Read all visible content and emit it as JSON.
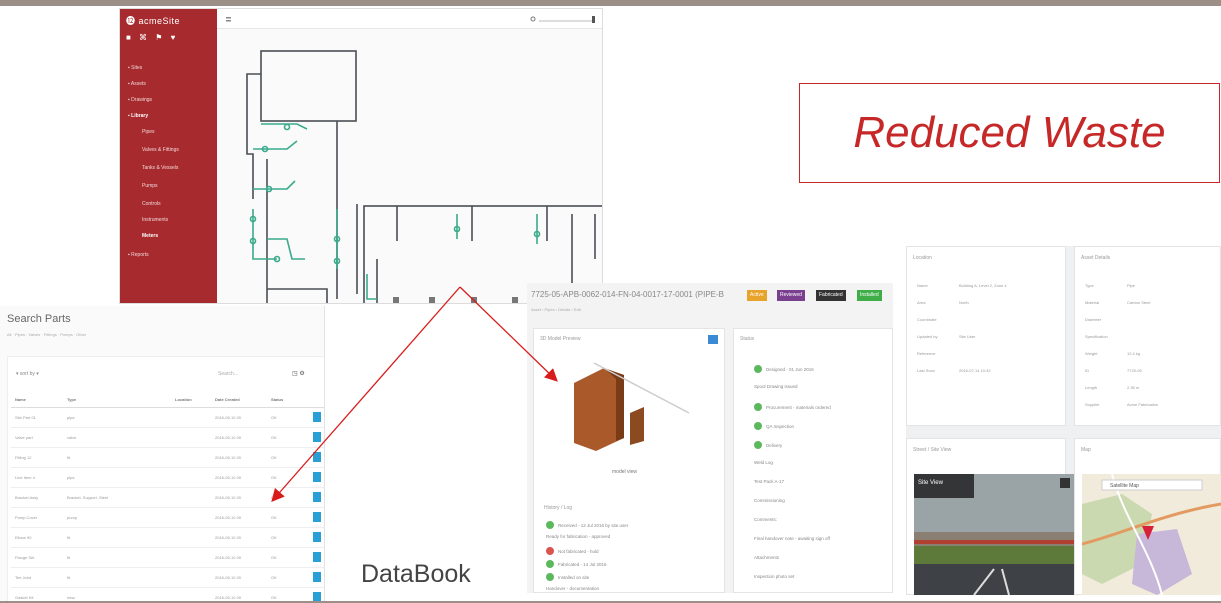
{
  "floorplan_app": {
    "brand": "⓬ acmeSite",
    "sidebar_icons": "■ ⌘ ⚑ ♥",
    "nav": [
      {
        "label": "▪ Sites"
      },
      {
        "label": "▪ Assets"
      },
      {
        "label": "▪ Drawings"
      },
      {
        "label": "▪ Library"
      },
      {
        "label": "Pipes"
      },
      {
        "label": "Valves & Fittings"
      },
      {
        "label": "Tanks & Vessels"
      },
      {
        "label": "Pumps"
      },
      {
        "label": "Controls"
      },
      {
        "label": "Instruments"
      },
      {
        "label": "Meters"
      },
      {
        "label": "▪ Reports"
      }
    ],
    "colors": {
      "sidebar": "#a62a2e",
      "pipe": "#3aaa8c"
    }
  },
  "callout": {
    "text": "Reduced Waste",
    "color": "#c62828"
  },
  "search_list": {
    "title": "Search Parts",
    "tabs": "All · Pipes · Valves · Fittings · Pumps · Other",
    "sort_label": "▾ sort by ▾",
    "search_placeholder": "Search...",
    "tools": "◳ ⚙",
    "columns": [
      "Name",
      "Type",
      "Location",
      "Date Created",
      "Status",
      ""
    ],
    "rows": [
      [
        "Site Part 01",
        "pipe",
        "",
        "2016-05-10 09",
        "OK"
      ],
      [
        "Valve part",
        "valve",
        "",
        "2016-05-10 09",
        "OK"
      ],
      [
        "Fitting 12",
        "fit",
        "",
        "2016-05-10 09",
        "OK"
      ],
      [
        "Line Item 4",
        "pipe",
        "",
        "2016-05-10 09",
        "OK"
      ],
      [
        "Bracket Assy",
        "Bracket, Support, Steel",
        "",
        "2016-05-10 09",
        "OK"
      ],
      [
        "Pump Cover",
        "pump",
        "",
        "2016-05-10 09",
        "OK"
      ],
      [
        "Elbow 90",
        "fit",
        "",
        "2016-05-10 09",
        "OK"
      ],
      [
        "Flange Set",
        "fit",
        "",
        "2016-05-10 09",
        "OK"
      ],
      [
        "Tee Joint",
        "fit",
        "",
        "2016-05-10 09",
        "OK"
      ],
      [
        "Gasket Kit",
        "misc",
        "",
        "2016-05-10 09",
        "OK"
      ]
    ]
  },
  "asset_detail": {
    "title": "7725-05-APB-0062-014-FN-04-0017-17-0001 (PIPE-B",
    "subtitle": "Asset › Pipes › Details › Edit",
    "badges": [
      {
        "label": "Active",
        "color": "#e8a32b"
      },
      {
        "label": "Reviewed",
        "color": "#7a3f8e"
      },
      {
        "label": "Fabricated",
        "color": "#333333"
      },
      {
        "label": "Installed",
        "color": "#3fae49"
      }
    ],
    "model_header": "3D Model Preview",
    "model_label": "model view",
    "history_header": "History / Log",
    "history": [
      {
        "text": "Received - 12 Jul 2016 by site.user",
        "status": "ok"
      },
      {
        "text": "Ready for fabrication - approved",
        "status": "none"
      },
      {
        "text": "Not fabricated - hold",
        "status": "bad"
      },
      {
        "text": "Fabricated - 14 Jul 2016",
        "status": "ok"
      },
      {
        "text": "Installed on site",
        "status": "ok"
      },
      {
        "text": "Handover - documentation",
        "status": "none"
      }
    ],
    "right_header": "Status",
    "right_lines": [
      {
        "text": "Designed - 01 Jun 2016",
        "status": "ok"
      },
      {
        "text": "Spool Drawing issued",
        "status": "none"
      },
      {
        "text": "Procurement - materials ordered",
        "status": "ok"
      },
      {
        "text": "QA Inspection",
        "status": "ok"
      },
      {
        "text": "Delivery",
        "status": "ok"
      },
      {
        "text": "Weld Log",
        "status": "none"
      },
      {
        "text": "Test Pack A-17",
        "status": "none"
      },
      {
        "text": "Commissioning",
        "status": "none"
      },
      {
        "text": "Comments:",
        "status": "none"
      },
      {
        "text": "Final handover note - awaiting sign off",
        "status": "none"
      },
      {
        "text": "Attachments",
        "status": "none"
      },
      {
        "text": "Inspection photo set",
        "status": "none"
      }
    ]
  },
  "databook_label": "DataBook",
  "asset_info": {
    "card1_header": "Location",
    "card1_rows": [
      [
        "Name",
        "Building A, Level 2, Zone 4"
      ],
      [
        "Area",
        "North"
      ],
      [
        "Coordinate",
        ""
      ],
      [
        "Updated by",
        "Site User"
      ],
      [
        "Reference",
        ""
      ],
      [
        "Last Scan",
        "2016-07-14 10:32"
      ]
    ],
    "card2_header": "Asset Details",
    "card2_rows": [
      [
        "Type",
        "Pipe"
      ],
      [
        "Material",
        "Carbon Steel"
      ],
      [
        "Diameter",
        ""
      ],
      [
        "Specification",
        ""
      ],
      [
        "Weight",
        "12.4 kg"
      ],
      [
        "ID",
        "7725-05"
      ],
      [
        "Length",
        "2.35 m"
      ],
      [
        "Supplier",
        "Acme Fabrication"
      ]
    ],
    "street_header": "Street / Site View",
    "street_label": "Site View",
    "map_header": "Map",
    "map_label": "Satellite   Map"
  }
}
